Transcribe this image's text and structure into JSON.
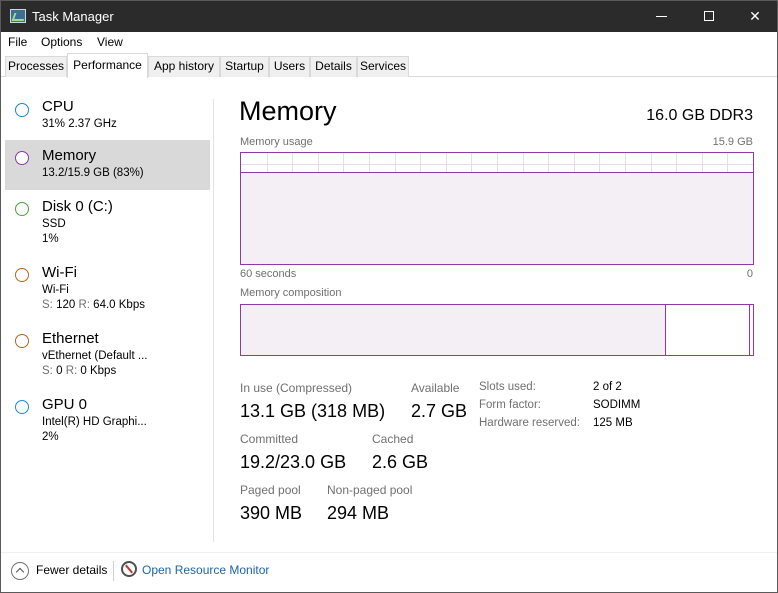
{
  "window": {
    "title": "Task Manager"
  },
  "menu": {
    "items": [
      "File",
      "Options",
      "View"
    ]
  },
  "tabs": [
    {
      "label": "Processes",
      "active": false
    },
    {
      "label": "Performance",
      "active": true
    },
    {
      "label": "App history",
      "active": false
    },
    {
      "label": "Startup",
      "active": false
    },
    {
      "label": "Users",
      "active": false
    },
    {
      "label": "Details",
      "active": false
    },
    {
      "label": "Services",
      "active": false
    }
  ],
  "sidebar": {
    "items": [
      {
        "name": "CPU",
        "line1": "31%  2.37 GHz",
        "line2": "",
        "color": "#1a8ad4",
        "selected": false
      },
      {
        "name": "Memory",
        "line1": "13.2/15.9 GB (83%)",
        "line2": "",
        "color": "#8b3aa6",
        "selected": true
      },
      {
        "name": "Disk 0 (C:)",
        "line1": "SSD",
        "line2": "1%",
        "color": "#4fa13b",
        "selected": false
      },
      {
        "name": "Wi-Fi",
        "line1": "Wi-Fi",
        "line2_send_label": "S:",
        "line2_send": "120",
        "line2_recv_label": "R:",
        "line2_recv": "64.0 Kbps",
        "color": "#b5651d",
        "selected": false
      },
      {
        "name": "Ethernet",
        "line1": "vEthernet (Default ...",
        "line2_send_label": "S:",
        "line2_send": "0",
        "line2_recv_label": "R:",
        "line2_recv": "0 Kbps",
        "color": "#b5651d",
        "selected": false
      },
      {
        "name": "GPU 0",
        "line1": "Intel(R) HD Graphi...",
        "line2": "2%",
        "color": "#1a8ad4",
        "selected": false
      }
    ]
  },
  "main": {
    "title": "Memory",
    "spec": "16.0 GB DDR3",
    "usage_label": "Memory usage",
    "usage_max": "15.9 GB",
    "usage_level": 0.83,
    "axis_left": "60 seconds",
    "axis_right": "0",
    "composition_label": "Memory composition",
    "composition_in_use_fraction": 0.83,
    "accent_color": "#8b3aa6",
    "stats": {
      "in_use_label": "In use (Compressed)",
      "in_use_value": "13.1 GB (318 MB)",
      "available_label": "Available",
      "available_value": "2.7 GB",
      "committed_label": "Committed",
      "committed_value": "19.2/23.0 GB",
      "cached_label": "Cached",
      "cached_value": "2.6 GB",
      "paged_label": "Paged pool",
      "paged_value": "390 MB",
      "nonpaged_label": "Non-paged pool",
      "nonpaged_value": "294 MB"
    },
    "details": {
      "slots_label": "Slots used:",
      "slots_value": "2 of 2",
      "form_label": "Form factor:",
      "form_value": "SODIMM",
      "hw_label": "Hardware reserved:",
      "hw_value": "125 MB"
    }
  },
  "footer": {
    "fewer_details": "Fewer details",
    "open_resource_monitor": "Open Resource Monitor"
  }
}
